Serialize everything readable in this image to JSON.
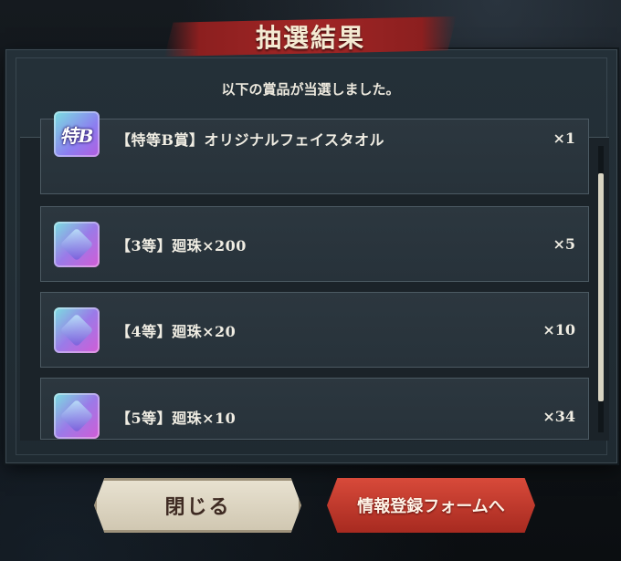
{
  "dialog": {
    "title": "抽選結果",
    "message": "以下の賞品が当選しました。"
  },
  "prizes": [
    {
      "icon": "special-b-icon",
      "icon_text": "特B",
      "name": "【特等B賞】オリジナルフェイスタオル",
      "qty": "×1"
    },
    {
      "icon": "orb-cube-icon",
      "name": "【3等】廻珠×200",
      "qty": "×5"
    },
    {
      "icon": "orb-cube-icon",
      "name": "【4等】廻珠×20",
      "qty": "×10"
    },
    {
      "icon": "orb-cube-icon",
      "name": "【5等】廻珠×10",
      "qty": "×34"
    }
  ],
  "buttons": {
    "close_label": "閉じる",
    "register_label": "情報登録フォームへ"
  },
  "colors": {
    "banner_red": "#a12626",
    "close_button": "#e9e3d2",
    "register_button": "#d84a3a",
    "panel_bg": "#243038"
  }
}
